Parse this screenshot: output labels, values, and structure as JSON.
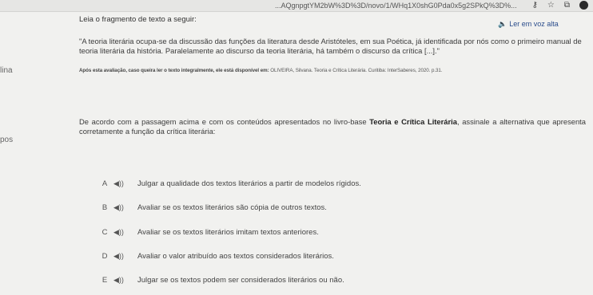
{
  "browser": {
    "url": "...AQgnpgtYM2bW%3D%3D/novo/1/WHq1X0shG0Pda0x5g2SPkQ%3D%...",
    "icons": [
      "key-icon",
      "star-icon",
      "extension-icon",
      "profile-icon"
    ]
  },
  "sidebar": {
    "partial_items": [
      "lina",
      "pos"
    ]
  },
  "question": {
    "prompt": "Leia o fragmento de texto a seguir:",
    "listen_label": "Ler em voz alta",
    "quote": "\"A teoria literária ocupa-se da discussão das funções da literatura desde Aristóteles, em sua Poética, já identificada por nós como o primeiro manual de teoria literária da história. Paralelamente ao discurso da teoria literária, há também o discurso da crítica [...].\"",
    "citation_bold": "Após esta avaliação, caso queira ler o texto integralmente, ele está disponível em:",
    "citation_rest": " OLIVEIRA, Silvana. Teoria e Crítica Literária. Curitiba: InterSaberes, 2020. p.31.",
    "statement_before": "De acordo com a passagem acima e com os conteúdos apresentados no livro-base ",
    "statement_bold": "Teoria e Crítica Literária",
    "statement_after": ", assinale a alternativa que apresenta corretamente a função da crítica literária:"
  },
  "options": [
    {
      "letter": "A",
      "text": "Julgar a qualidade dos textos literários a partir de modelos rígidos."
    },
    {
      "letter": "B",
      "text": "Avaliar se os textos literários são cópia de outros textos."
    },
    {
      "letter": "C",
      "text": "Avaliar se os textos literários imitam textos anteriores."
    },
    {
      "letter": "D",
      "text": "Avaliar o valor atribuído aos textos considerados literários."
    },
    {
      "letter": "E",
      "text": "Julgar se os textos podem ser considerados literários ou não."
    }
  ]
}
